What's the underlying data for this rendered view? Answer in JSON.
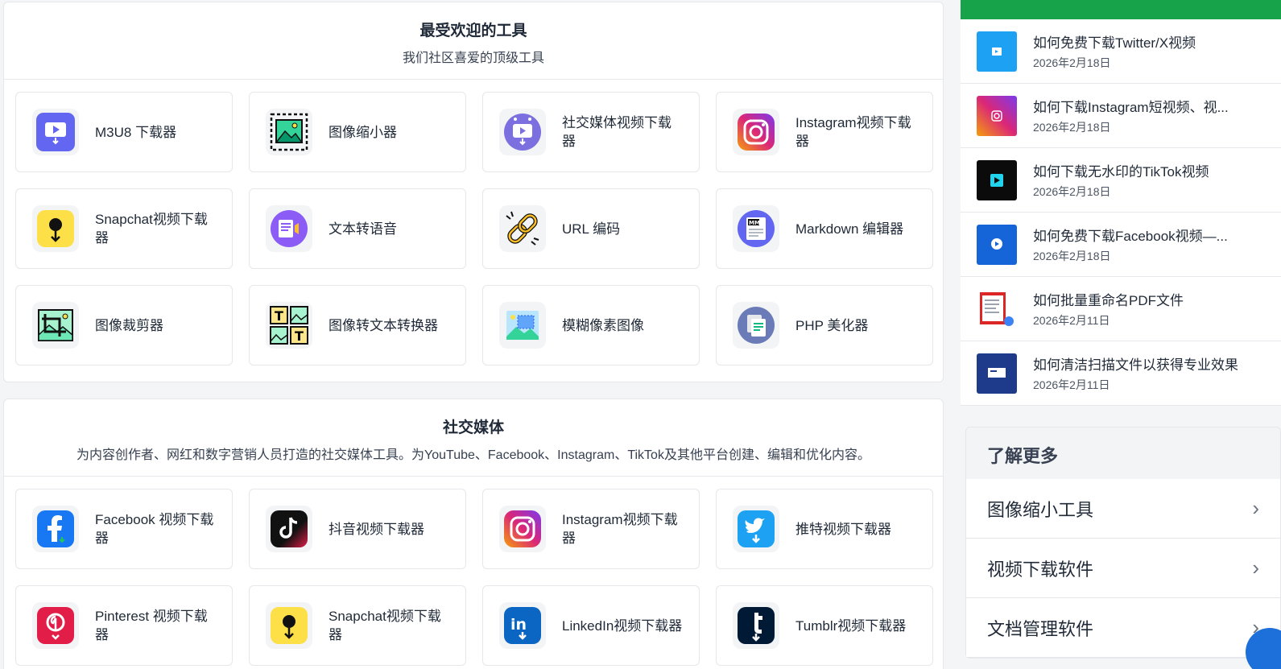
{
  "popular": {
    "title": "最受欢迎的工具",
    "subtitle": "我们社区喜爱的顶级工具",
    "tools": [
      {
        "label": "M3U8 下载器",
        "icon": "video-download-icon"
      },
      {
        "label": "图像缩小器",
        "icon": "image-resize-icon"
      },
      {
        "label": "社交媒体视频下载器",
        "icon": "social-video-icon"
      },
      {
        "label": "Instagram视频下载器",
        "icon": "instagram-icon"
      },
      {
        "label": "Snapchat视频下载器",
        "icon": "snapchat-icon"
      },
      {
        "label": "文本转语音",
        "icon": "text-to-speech-icon"
      },
      {
        "label": "URL 编码",
        "icon": "link-icon"
      },
      {
        "label": "Markdown 编辑器",
        "icon": "markdown-icon"
      },
      {
        "label": "图像裁剪器",
        "icon": "crop-icon"
      },
      {
        "label": "图像转文本转换器",
        "icon": "image-to-text-icon"
      },
      {
        "label": "模糊像素图像",
        "icon": "pixelate-icon"
      },
      {
        "label": "PHP 美化器",
        "icon": "php-icon"
      }
    ]
  },
  "social": {
    "title": "社交媒体",
    "subtitle": "为内容创作者、网红和数字营销人员打造的社交媒体工具。为YouTube、Facebook、Instagram、TikTok及其他平台创建、编辑和优化内容。",
    "tools": [
      {
        "label": "Facebook 视频下载器",
        "icon": "facebook-icon"
      },
      {
        "label": "抖音视频下载器",
        "icon": "tiktok-icon"
      },
      {
        "label": "Instagram视频下载器",
        "icon": "instagram-icon"
      },
      {
        "label": "推特视频下载器",
        "icon": "twitter-icon"
      },
      {
        "label": "Pinterest 视频下载器",
        "icon": "pinterest-icon"
      },
      {
        "label": "Snapchat视频下载器",
        "icon": "snapchat-icon"
      },
      {
        "label": "LinkedIn视频下载器",
        "icon": "linkedin-icon"
      },
      {
        "label": "Tumblr视频下载器",
        "icon": "tumblr-icon"
      }
    ]
  },
  "posts": [
    {
      "title": "如何免费下载Twitter/X视频",
      "date": "2026年2月18日",
      "thumb": "twitter-thumb-icon"
    },
    {
      "title": "如何下载Instagram短视频、视...",
      "date": "2026年2月18日",
      "thumb": "instagram-thumb-icon"
    },
    {
      "title": "如何下载无水印的TikTok视频",
      "date": "2026年2月18日",
      "thumb": "tiktok-thumb-icon"
    },
    {
      "title": "如何免费下载Facebook视频—...",
      "date": "2026年2月18日",
      "thumb": "facebook-thumb-icon"
    },
    {
      "title": "如何批量重命名PDF文件",
      "date": "2026年2月11日",
      "thumb": "pdf-thumb-icon"
    },
    {
      "title": "如何清洁扫描文件以获得专业效果",
      "date": "2026年2月11日",
      "thumb": "scan-thumb-icon"
    }
  ],
  "learn_more": {
    "title": "了解更多",
    "items": [
      "图像缩小工具",
      "视频下载软件",
      "文档管理软件"
    ]
  },
  "colors": {
    "accent_green": "#16a34a",
    "fab_blue": "#1d6fd9"
  }
}
